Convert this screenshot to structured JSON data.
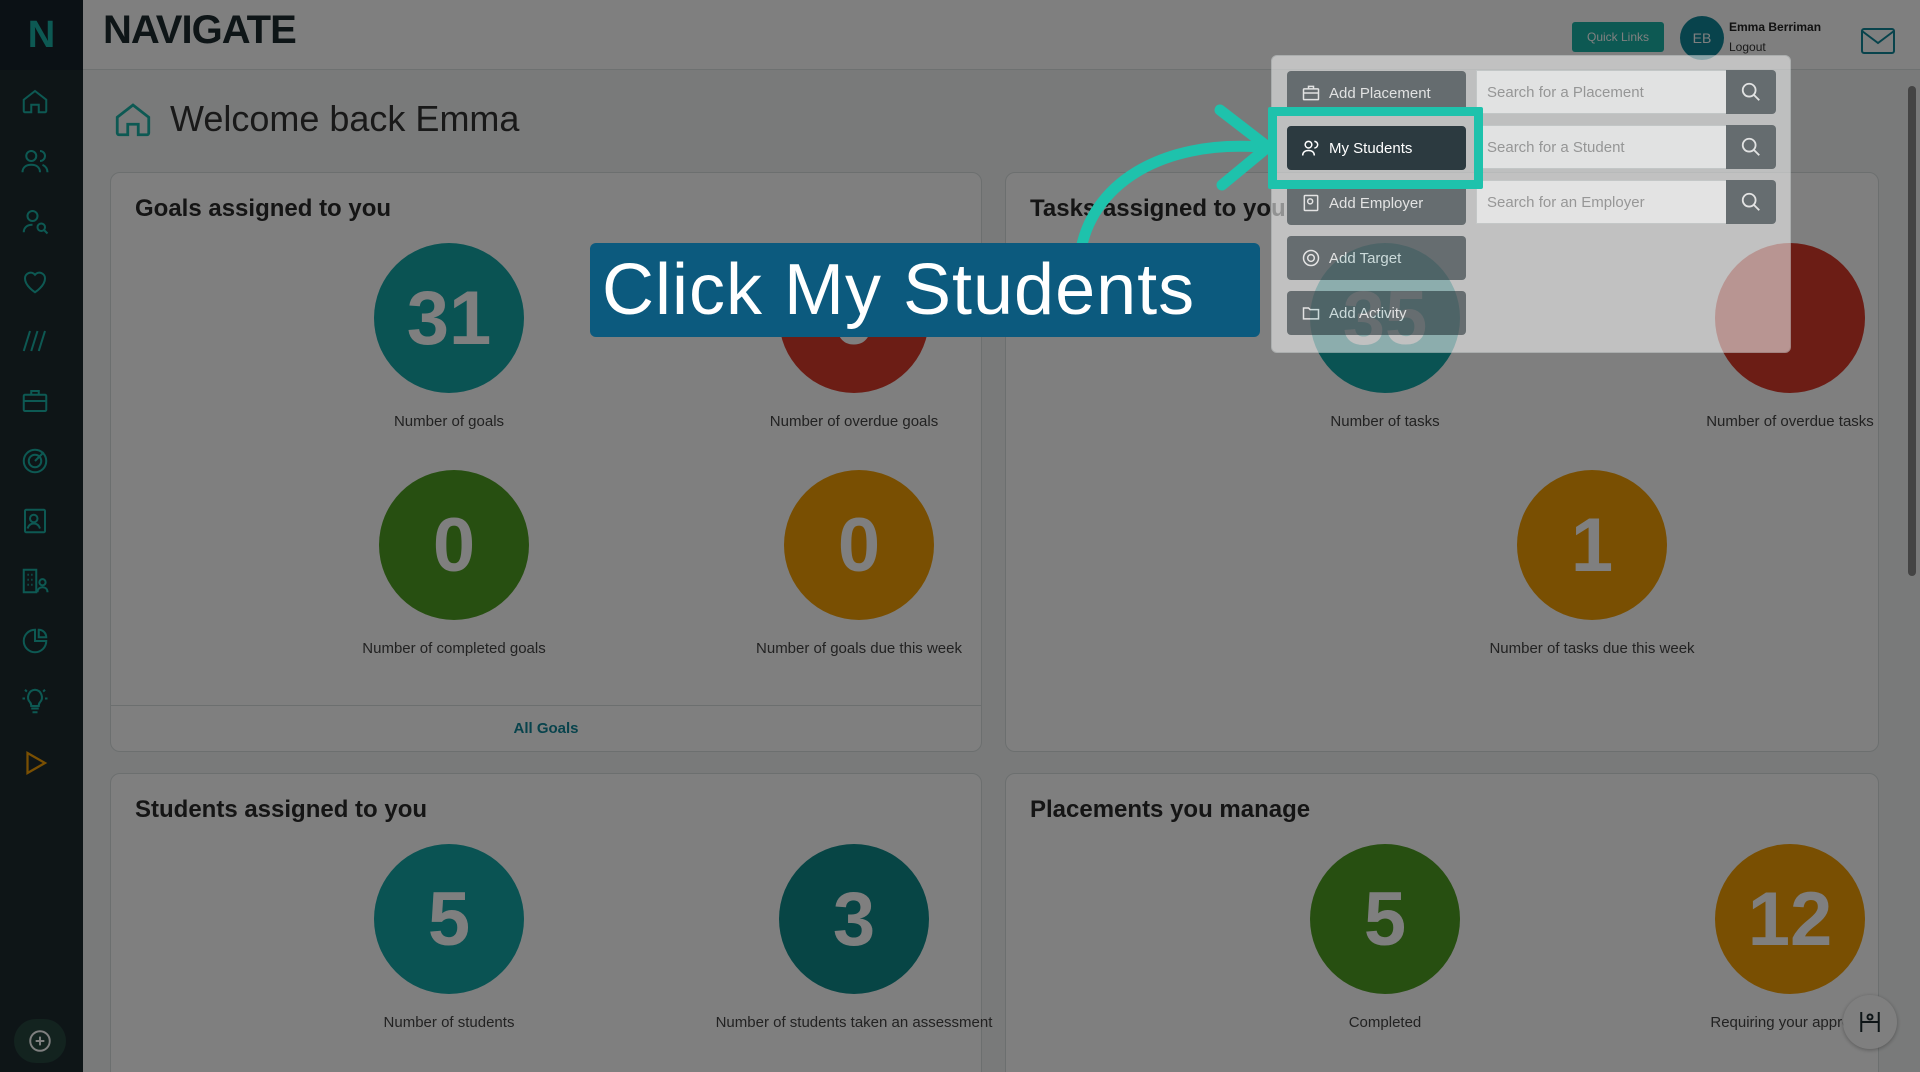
{
  "app": {
    "logo_letter": "N",
    "brand": "NAVIGATE"
  },
  "header": {
    "quick_links": "Quick Links",
    "user_initials": "EB",
    "user_name": "Emma Berriman",
    "logout": "Logout"
  },
  "page": {
    "title": "Welcome back Emma"
  },
  "cards": {
    "goals": {
      "title": "Goals assigned to you",
      "stats": [
        {
          "value": "31",
          "label": "Number of goals",
          "color": "#15a7a7"
        },
        {
          "value": "0",
          "label": "Number of overdue goals",
          "color": "#d93a2b"
        },
        {
          "value": "0",
          "label": "Number of completed goals",
          "color": "#4f9f23"
        },
        {
          "value": "0",
          "label": "Number of goals due this week",
          "color": "#f29f05"
        }
      ],
      "footer": "All Goals"
    },
    "tasks": {
      "title": "Tasks assigned to you",
      "stats": [
        {
          "value": "35",
          "label": "Number of tasks",
          "color": "#15a7a7"
        },
        {
          "value": "",
          "label": "Number of overdue tasks",
          "color": "#d93a2b"
        },
        {
          "value": "1",
          "label": "Number of tasks due this week",
          "color": "#f29f05"
        }
      ]
    },
    "students": {
      "title": "Students assigned to you",
      "stats": [
        {
          "value": "5",
          "label": "Number of students",
          "color": "#15a7a7"
        },
        {
          "value": "3",
          "label": "Number of students taken an assessment",
          "color": "#0f8a8a"
        }
      ]
    },
    "placements": {
      "title": "Placements you manage",
      "stats": [
        {
          "value": "5",
          "label": "Completed",
          "color": "#4f9f23"
        },
        {
          "value": "12",
          "label": "Requiring your approval",
          "color": "#f29f05"
        }
      ]
    }
  },
  "quick_links_menu": {
    "buttons": [
      {
        "label": "Add Placement",
        "icon": "briefcase-icon"
      },
      {
        "label": "My Students",
        "icon": "users-icon"
      },
      {
        "label": "Add Employer",
        "icon": "contact-card-icon"
      },
      {
        "label": "Add Target",
        "icon": "target-icon"
      },
      {
        "label": "Add Activity",
        "icon": "folder-icon"
      }
    ],
    "searches": [
      {
        "placeholder": "Search for a Placement"
      },
      {
        "placeholder": "Search for a Student"
      },
      {
        "placeholder": "Search for an Employer"
      }
    ]
  },
  "tutorial": {
    "callout": "Click My Students",
    "accent": "#1ec2ac"
  }
}
